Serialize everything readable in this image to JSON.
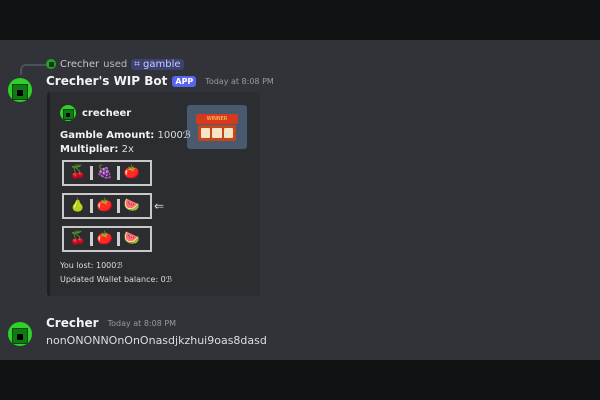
{
  "reply": {
    "user": "Crecher",
    "used_text": "used",
    "command_icon": "slash-command-icon",
    "command": "gamble"
  },
  "bot_message": {
    "username": "Crecher's WIP Bot",
    "badge": "APP",
    "timestamp": "Today at 8:08 PM",
    "embed": {
      "author": "crecheer",
      "amount_label": "Gamble Amount:",
      "amount_value": "1000ℬ",
      "multiplier_label": "Multiplier:",
      "multiplier_value": "2x",
      "thumbnail_text": "WINNER",
      "reels": [
        [
          "🍒",
          "🍇",
          "🍅"
        ],
        [
          "🍐",
          "🍅",
          "🍉"
        ],
        [
          "🍒",
          "🍅",
          "🍉"
        ]
      ],
      "arrow": "⇐",
      "result_line1": "You lost: 1000ℬ",
      "result_line2": "Updated Wallet balance: 0ℬ"
    }
  },
  "user_message": {
    "username": "Crecher",
    "timestamp": "Today at 8:08 PM",
    "text": "nonONONNOnOnOnasdjkzhui9oas8dasd"
  },
  "colors": {
    "background": "#313338",
    "embed": "#2b2d31",
    "app_badge": "#5865f2",
    "avatar_green": "#2fd02a"
  }
}
